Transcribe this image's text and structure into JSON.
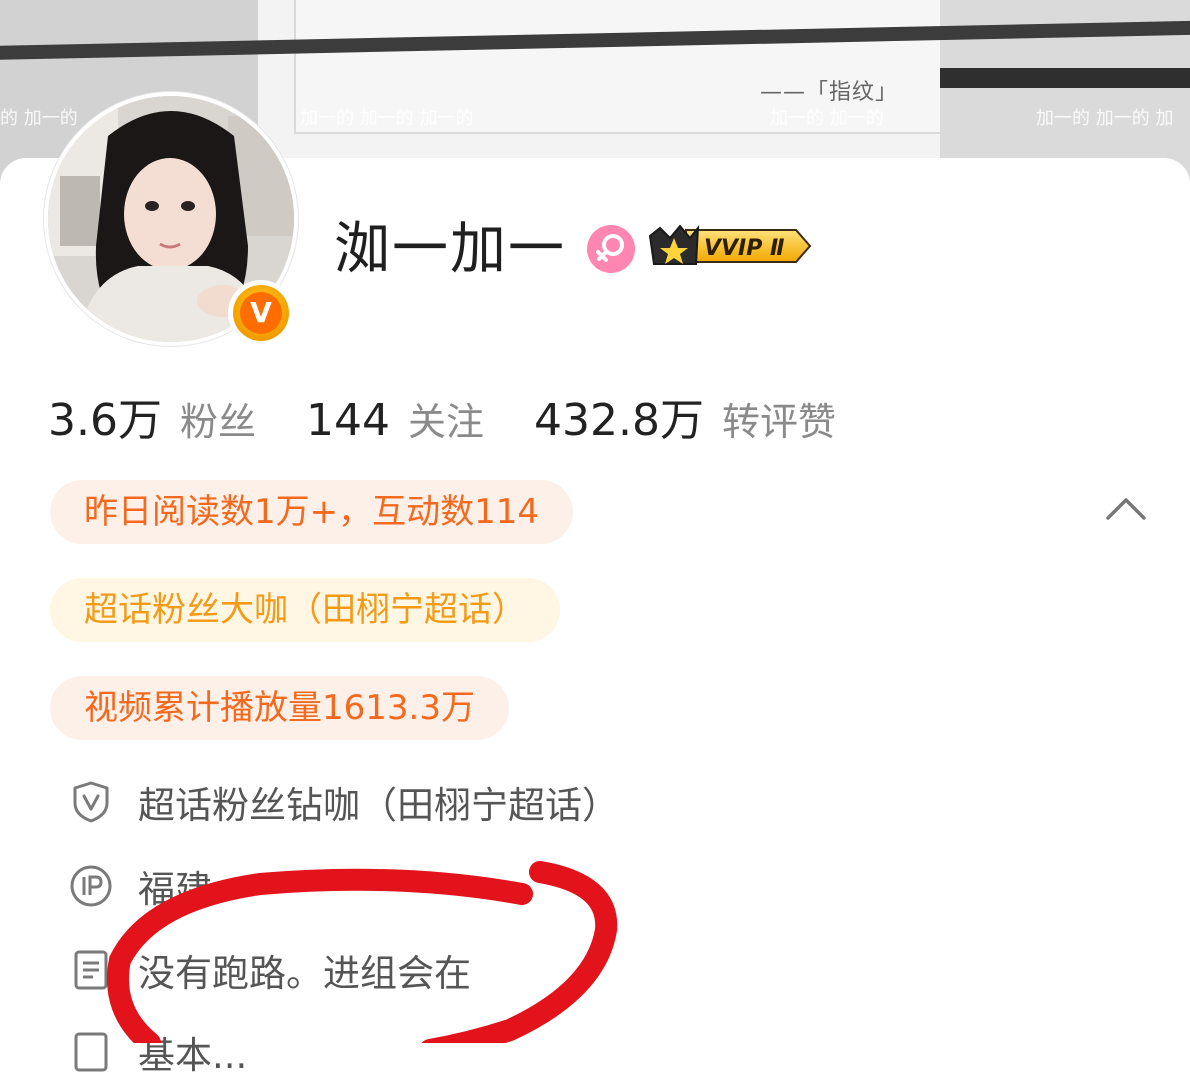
{
  "cover": {
    "caption": "——「指纹」",
    "watermark_1": "的 加一的",
    "watermark_2": "加一的 加一的 加一的",
    "watermark_3": "加一的 加一的",
    "watermark_4": "加一的 加一的 加"
  },
  "profile": {
    "name": "洳一加一",
    "gender_icon": "female-icon",
    "membership_badge": "VVIP Ⅱ",
    "verified_badge_letter": "V"
  },
  "stats": [
    {
      "value": "3.6万",
      "label": "粉丝"
    },
    {
      "value": "144",
      "label": "关注"
    },
    {
      "value": "432.8万",
      "label": "转评赞"
    }
  ],
  "tags": {
    "reading": "昨日阅读数1万+，互动数114",
    "super_topic_fan": "超话粉丝大咖（田栩宁超话）",
    "video_plays": "视频累计播放量1613.3万"
  },
  "info": {
    "super_topic_diamond": "超话粉丝钻咖（田栩宁超话）",
    "ip_location": "福建",
    "bio": "没有跑路。进组会在",
    "partial_row": "基本..."
  },
  "colors": {
    "tag_orange": "#f36a1f",
    "tag_gold": "#f39a17",
    "annotation_red": "#e3131b"
  }
}
